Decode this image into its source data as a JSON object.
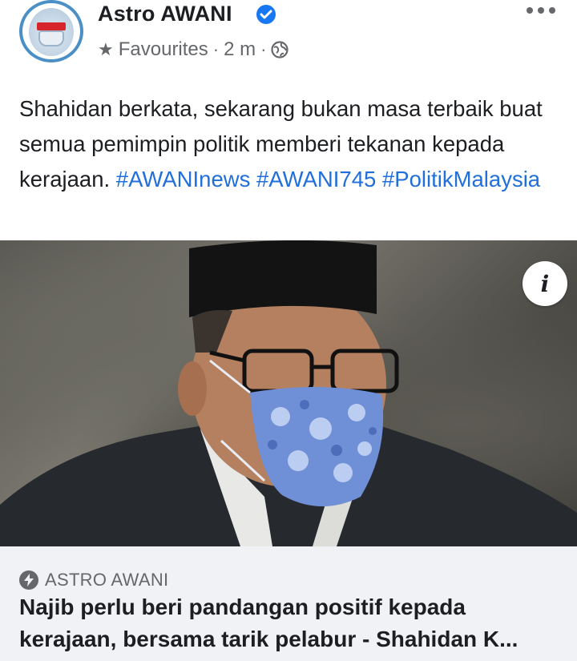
{
  "page": {
    "name": "Astro AWANI",
    "verified": true,
    "avatar_badge_text": "ASTRO AWANI"
  },
  "meta": {
    "audience": "Favourites",
    "separator": "·",
    "time": "2 m",
    "privacy_icon": "globe-icon"
  },
  "caption": {
    "text": "Shahidan berkata, sekarang bukan masa terbaik buat semua pemimpin politik memberi tekanan kepada kerajaan. ",
    "hashtags": [
      "#AWANInews",
      "#AWANI745",
      "#PolitikMalaysia"
    ]
  },
  "photo": {
    "info_label": "i"
  },
  "link_preview": {
    "source": "ASTRO AWANI",
    "title": "Najib perlu beri pandangan positif kepada kerajaan, bersama tarik pelabur - Shahidan K..."
  },
  "colors": {
    "hashtag": "#216fdb",
    "verified": "#1877f2",
    "meta_text": "#65676b",
    "link_bg": "#f0f2f5"
  }
}
